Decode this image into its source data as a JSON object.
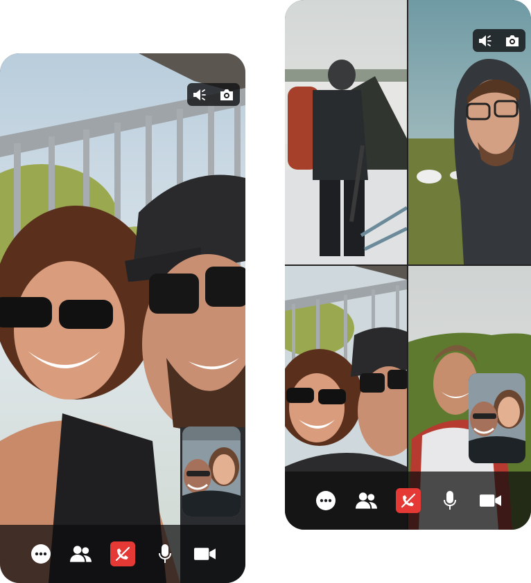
{
  "colors": {
    "end_call": "#e53935",
    "control_bar": "#0c0c0e",
    "icon": "#ffffff"
  },
  "left_phone": {
    "top_controls": [
      "speaker-icon",
      "camera-switch-icon"
    ],
    "call_controls": [
      "more-icon",
      "participants-icon",
      "end-call-icon",
      "microphone-icon",
      "video-camera-icon"
    ]
  },
  "right_phone": {
    "tiles": [
      "hiker-selfie",
      "hooded-man-selfie",
      "couple-selfie",
      "mountain-selfie"
    ],
    "top_controls": [
      "speaker-icon",
      "camera-switch-icon"
    ],
    "call_controls": [
      "more-icon",
      "participants-icon",
      "end-call-icon",
      "microphone-icon",
      "video-camera-icon"
    ]
  }
}
